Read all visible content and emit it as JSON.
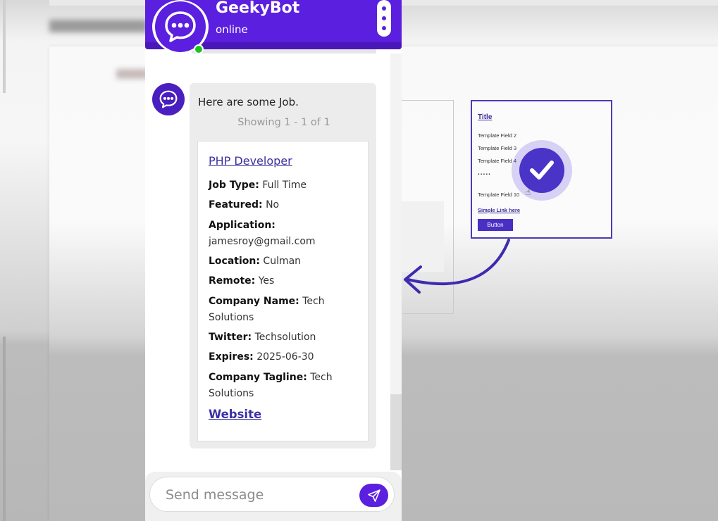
{
  "colors": {
    "brand": "#5b1fe0",
    "online": "#1fc31f",
    "link": "#3a2fa3"
  },
  "header": {
    "bot_name": "GeekyBot",
    "status": "online",
    "avatar_icon": "chat-bubble-icon",
    "menu_icon": "vertical-dots-icon"
  },
  "message": {
    "intro": "Here are some Job.",
    "count": "Showing 1 - 1 of 1",
    "job": {
      "title": "PHP Developer",
      "fields": [
        {
          "label": "Job Type:",
          "value": "Full Time"
        },
        {
          "label": "Featured:",
          "value": "No"
        },
        {
          "label": "Application:",
          "value": "jamesroy@gmail.com"
        },
        {
          "label": "Location:",
          "value": "Culman"
        },
        {
          "label": "Remote:",
          "value": "Yes"
        },
        {
          "label": "Company Name:",
          "value": "Tech Solutions"
        },
        {
          "label": "Twitter:",
          "value": "Techsolution"
        },
        {
          "label": "Expires:",
          "value": "2025-06-30"
        },
        {
          "label": "Company Tagline:",
          "value": "Tech Solutions"
        }
      ],
      "website_label": "Website"
    }
  },
  "composer": {
    "placeholder": "Send message",
    "send_icon": "paper-plane-icon"
  },
  "illustration": {
    "title": "Title",
    "fields": [
      "Template Field 2",
      "Template Field 3",
      "Template Field 4"
    ],
    "ellipsis": ".....",
    "field_last": "Template Field 10",
    "link": "Simple Link here",
    "button": "Button",
    "check_icon": "checkmark-icon",
    "cursor_icon": "hand-cursor-icon"
  }
}
